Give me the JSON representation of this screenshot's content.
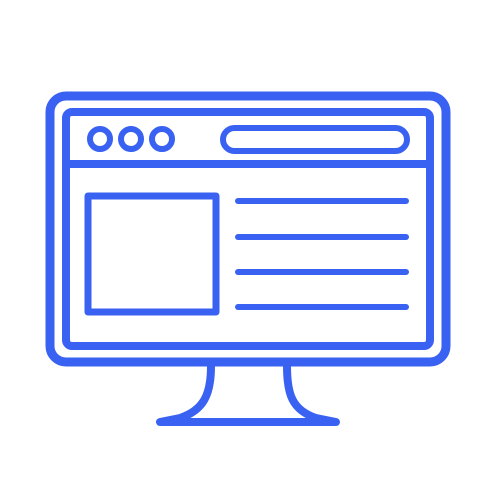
{
  "icon": {
    "name": "desktop-monitor-browser-icon",
    "stroke_color": "#3a62f2",
    "background_color": "#ffffff",
    "parts": {
      "monitor": "monitor-icon",
      "browser_window": "browser-window-icon",
      "window_controls": [
        "window-control-dot-icon",
        "window-control-dot-icon",
        "window-control-dot-icon"
      ],
      "address_bar": "address-bar-icon",
      "image_placeholder": "image-placeholder-icon",
      "text_lines": [
        "text-line-icon",
        "text-line-icon",
        "text-line-icon",
        "text-line-icon"
      ],
      "stand": "monitor-stand-icon"
    }
  }
}
